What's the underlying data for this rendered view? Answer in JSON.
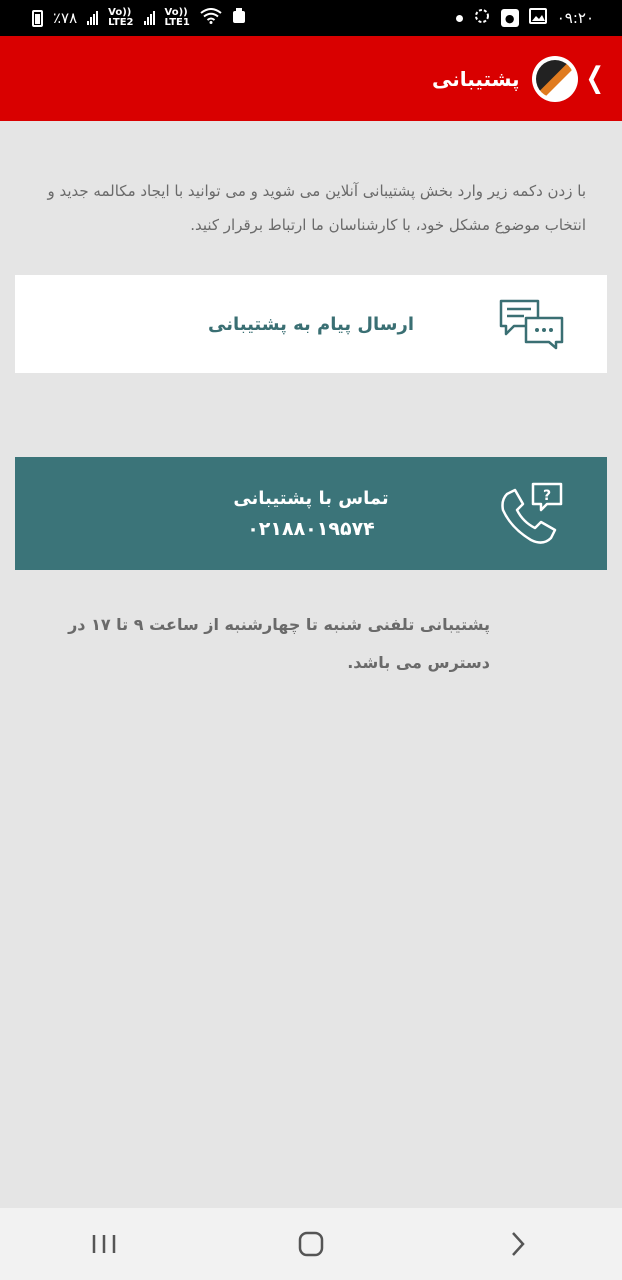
{
  "status_bar": {
    "time": "۰۹:۲۰",
    "battery": "٪۷۸",
    "sim2_label": "LTE2",
    "sim1_label": "LTE1",
    "volte": "Vo))"
  },
  "app_bar": {
    "title": "پشتیبانی"
  },
  "intro": {
    "text": "با زدن دکمه زیر وارد بخش پشتیبانی آنلاین می شوید و می توانید با ایجاد مکالمه جدید و انتخاب موضوع مشکل خود، با کارشناسان ما ارتباط برقرار کنید."
  },
  "message_card": {
    "label": "ارسال پیام به پشتیبانی"
  },
  "call_card": {
    "title": "تماس با پشتیبانی",
    "number": "۰۲۱۸۸۰۱۹۵۷۴"
  },
  "hours": {
    "text": "پشتیبانی تلفنی شنبه تا چهارشنبه از ساعت ۹ تا ۱۷ در دسترس می باشد."
  },
  "colors": {
    "app_bar": "#d90000",
    "call_card": "#3b7479",
    "message_label": "#3a6f73"
  }
}
